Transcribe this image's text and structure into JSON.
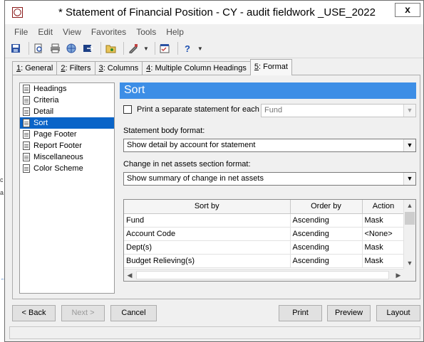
{
  "window": {
    "title": "* Statement of Financial Position - CY - audit fieldwork _USE_2022",
    "close_label": "x"
  },
  "left_strip": {
    "marks": [
      "c",
      "a",
      "←"
    ]
  },
  "menu": [
    "File",
    "Edit",
    "View",
    "Favorites",
    "Tools",
    "Help"
  ],
  "toolbar": {
    "icons": [
      {
        "name": "save-icon",
        "glyph": "💾"
      },
      {
        "name": "print-preview-icon",
        "glyph": "🔍"
      },
      {
        "name": "print-icon",
        "glyph": "⎙"
      },
      {
        "name": "network-icon",
        "glyph": "☷"
      },
      {
        "name": "export-icon",
        "glyph": "⇨"
      },
      {
        "name": "open-folder-icon",
        "glyph": "📂"
      },
      {
        "name": "format-tools-icon",
        "glyph": "✎"
      },
      {
        "name": "properties-icon",
        "glyph": "☑"
      },
      {
        "name": "help-icon",
        "glyph": "?"
      }
    ]
  },
  "tabs": [
    {
      "key": "1",
      "label": ": General"
    },
    {
      "key": "2",
      "label": ": Filters"
    },
    {
      "key": "3",
      "label": ": Columns"
    },
    {
      "key": "4",
      "label": ": Multiple Column Headings"
    },
    {
      "key": "5",
      "label": ": Format"
    }
  ],
  "nav": {
    "items": [
      "Headings",
      "Criteria",
      "Detail",
      "Sort",
      "Page Footer",
      "Report Footer",
      "Miscellaneous",
      "Color Scheme"
    ],
    "selected": "Sort"
  },
  "section": {
    "title": "Sort",
    "separate_statement_label": "Print a separate statement for each",
    "separate_statement_checked": false,
    "separate_statement_value": "Fund",
    "body_format_label": "Statement body format:",
    "body_format_value": "Show detail by account for statement",
    "change_label": "Change in net assets section format:",
    "change_value": "Show summary of change in net assets"
  },
  "sort_grid": {
    "headers": [
      "Sort by",
      "Order by",
      "Action"
    ],
    "rows": [
      [
        "Fund",
        "Ascending",
        "Mask"
      ],
      [
        "Account Code",
        "Ascending",
        "<None>"
      ],
      [
        "Dept(s)",
        "Ascending",
        "Mask"
      ],
      [
        "Budget Relieving(s)",
        "Ascending",
        "Mask"
      ]
    ]
  },
  "buttons": {
    "back": "< Back",
    "next": "Next >",
    "cancel": "Cancel",
    "print": "Print",
    "preview": "Preview",
    "layout": "Layout"
  },
  "colors": {
    "accent": "#3d8ee6",
    "selection": "#0a64c8"
  }
}
